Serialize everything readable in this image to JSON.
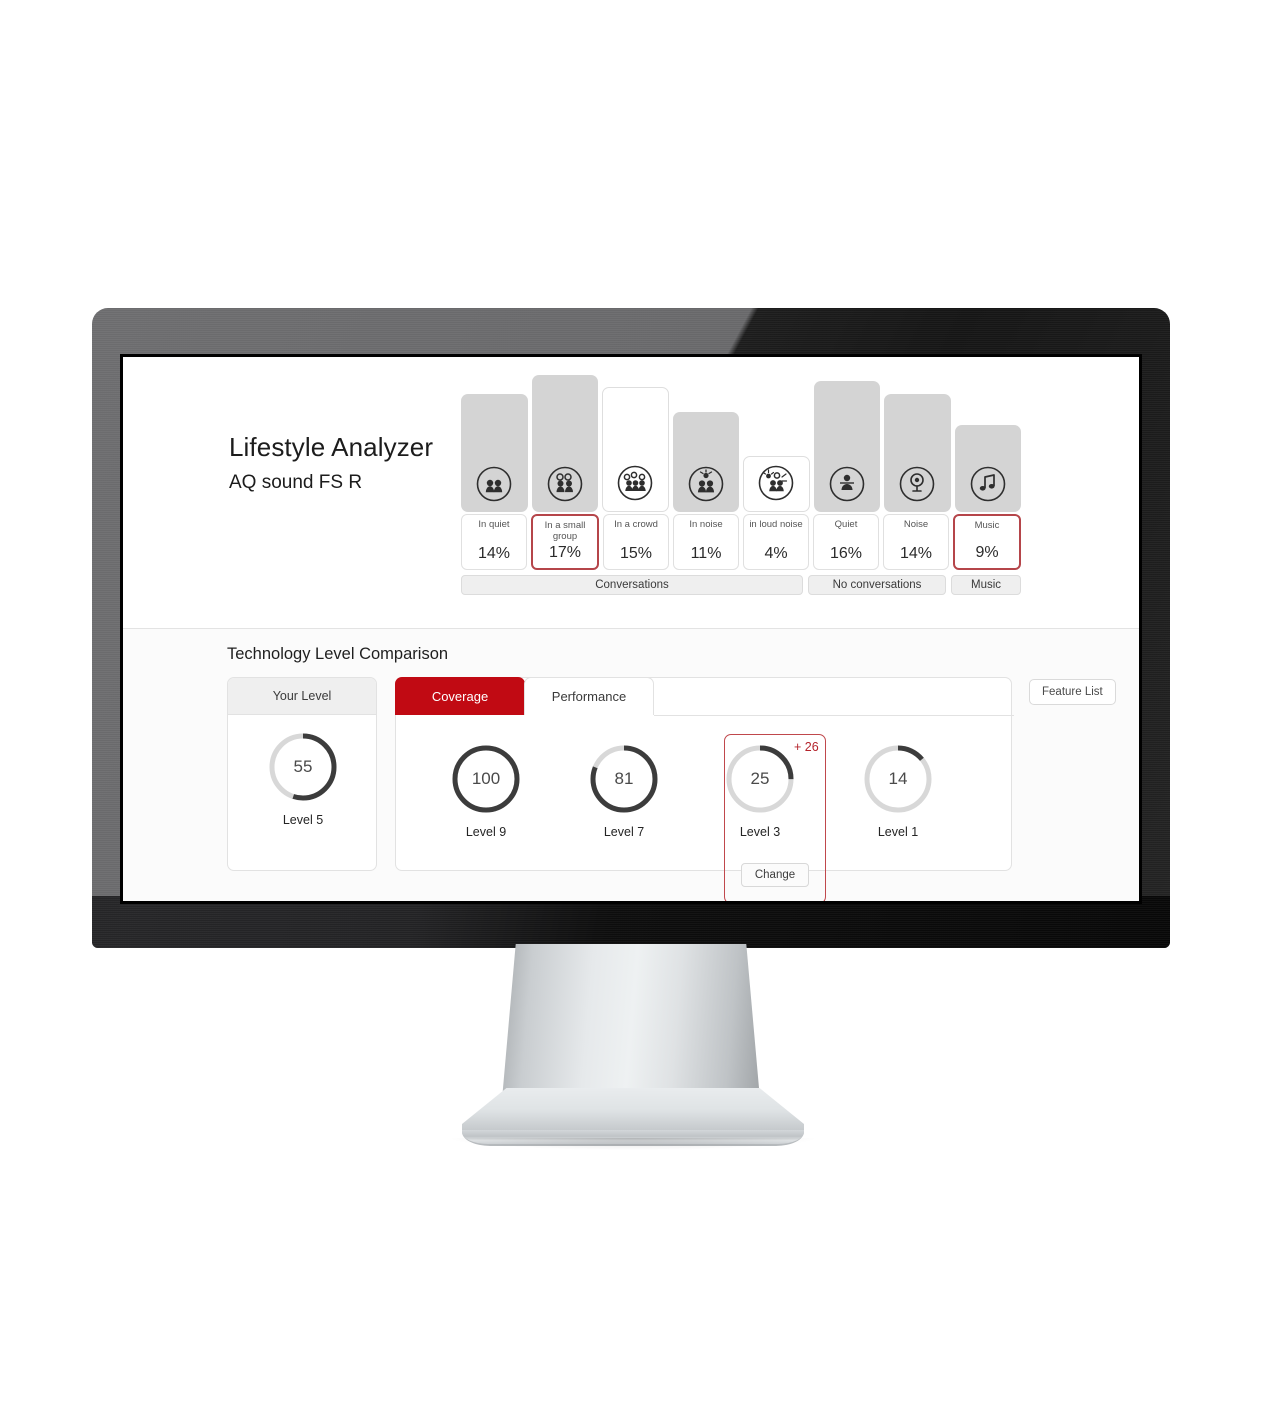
{
  "app": {
    "title": "Lifestyle Analyzer",
    "subtitle": "AQ sound FS R"
  },
  "colors": {
    "accent_red": "#c10a13",
    "highlight_border": "#b5454a",
    "bar_fill": "#d4d4d4",
    "gauge_track": "#d8d8d8",
    "gauge_arc": "#3c3c3c"
  },
  "chart_data": {
    "type": "bar",
    "title": "Lifestyle Analyzer",
    "categories": [
      "In quiet",
      "In a small group",
      "In a crowd",
      "In noise",
      "in loud noise",
      "Quiet",
      "Noise",
      "Music"
    ],
    "values": [
      14,
      17,
      15,
      11,
      4,
      16,
      14,
      9
    ],
    "value_labels": [
      "14%",
      "17%",
      "15%",
      "11%",
      "4%",
      "16%",
      "14%",
      "9%"
    ],
    "xlabel": "",
    "ylabel": "",
    "ylim": [
      0,
      17
    ],
    "grid": false,
    "bars": [
      {
        "label": "In quiet",
        "value": 14,
        "value_label": "14%",
        "style": "filled",
        "highlighted": false,
        "icon": "two-people-quiet-icon"
      },
      {
        "label": "In a small group",
        "value": 17,
        "value_label": "17%",
        "style": "filled",
        "highlighted": true,
        "icon": "small-group-icon"
      },
      {
        "label": "In a crowd",
        "value": 15,
        "value_label": "15%",
        "style": "hollow",
        "highlighted": false,
        "icon": "crowd-icon"
      },
      {
        "label": "In noise",
        "value": 11,
        "value_label": "11%",
        "style": "filled",
        "highlighted": false,
        "icon": "people-in-noise-icon"
      },
      {
        "label": "in loud noise",
        "value": 4,
        "value_label": "4%",
        "style": "hollow",
        "highlighted": false,
        "icon": "people-in-loud-noise-icon"
      },
      {
        "label": "Quiet",
        "value": 16,
        "value_label": "16%",
        "style": "filled",
        "highlighted": false,
        "icon": "single-person-quiet-icon"
      },
      {
        "label": "Noise",
        "value": 14,
        "value_label": "14%",
        "style": "filled",
        "highlighted": false,
        "icon": "speaker-noise-icon"
      },
      {
        "label": "Music",
        "value": 9,
        "value_label": "9%",
        "style": "filled",
        "highlighted": true,
        "icon": "music-note-icon"
      }
    ],
    "legend": {
      "position": "bottom",
      "entries": [
        "Conversations",
        "No conversations",
        "Music"
      ]
    }
  },
  "comparison": {
    "section_title": "Technology Level Comparison",
    "your_level": {
      "header": "Your Level",
      "gauge": {
        "value": 55,
        "value_label": "55",
        "level_label": "Level 5",
        "percent": 55
      }
    },
    "tabs": [
      {
        "id": "coverage",
        "label": "Coverage",
        "active": true
      },
      {
        "id": "performance",
        "label": "Performance",
        "active": false
      }
    ],
    "feature_list_button": "Feature List",
    "gauges": [
      {
        "value": 100,
        "value_label": "100",
        "level_label": "Level 9",
        "percent": 100,
        "highlighted": false
      },
      {
        "value": 81,
        "value_label": "81",
        "level_label": "Level 7",
        "percent": 81,
        "highlighted": true
      },
      {
        "value": 25,
        "value_label": "25",
        "level_label": "Level 3",
        "percent": 25,
        "highlighted": false
      },
      {
        "value": 14,
        "value_label": "14",
        "level_label": "Level 1",
        "percent": 14,
        "highlighted": false
      }
    ],
    "badge_delta": "+ 26",
    "change_button": "Change"
  }
}
